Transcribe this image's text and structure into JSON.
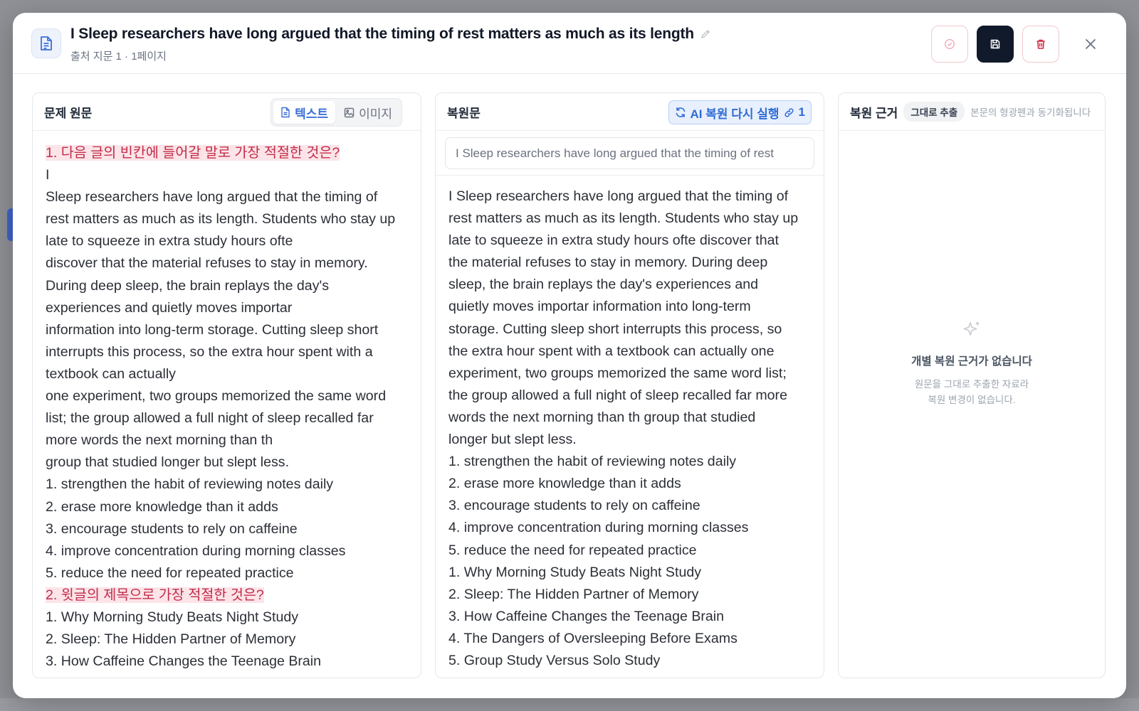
{
  "header": {
    "title": "I Sleep researchers have long argued that the timing of rest matters as much as its length",
    "subtitle": "출처 지문 1 · 1페이지"
  },
  "source_panel": {
    "title": "문제 원문",
    "tab_text": "텍스트",
    "tab_image": "이미지",
    "lines": [
      {
        "text": "1. 다음 글의 빈칸에 들어갈 말로 가장 적절한 것은?",
        "highlight": true
      },
      {
        "text": "I",
        "highlight": false
      },
      {
        "text": "Sleep researchers have long argued that the timing of",
        "highlight": false
      },
      {
        "text": "rest matters as much as its length. Students who stay up",
        "highlight": false
      },
      {
        "text": "late to squeeze in extra study hours ofte",
        "highlight": false
      },
      {
        "text": "discover that the material refuses to stay in memory.",
        "highlight": false
      },
      {
        "text": "During deep sleep, the brain replays the day's",
        "highlight": false
      },
      {
        "text": "experiences and quietly moves importar",
        "highlight": false
      },
      {
        "text": "information into long-term storage. Cutting sleep short",
        "highlight": false
      },
      {
        "text": "interrupts this process, so the extra hour spent with a",
        "highlight": false
      },
      {
        "text": "textbook can actually",
        "highlight": false
      },
      {
        "text": "one experiment, two groups memorized the same word",
        "highlight": false
      },
      {
        "text": "list; the group allowed a full night of sleep recalled far",
        "highlight": false
      },
      {
        "text": "more words the next morning than th",
        "highlight": false
      },
      {
        "text": "group that studied longer but slept less.",
        "highlight": false
      },
      {
        "text": "1. strengthen the habit of reviewing notes daily",
        "highlight": false
      },
      {
        "text": "2. erase more knowledge than it adds",
        "highlight": false
      },
      {
        "text": "3. encourage students to rely on caffeine",
        "highlight": false
      },
      {
        "text": "4. improve concentration during morning classes",
        "highlight": false
      },
      {
        "text": "5. reduce the need for repeated practice",
        "highlight": false
      },
      {
        "text": "2. 윗글의 제목으로 가장 적절한 것은?",
        "highlight": true
      },
      {
        "text": "1. Why Morning Study Beats Night Study",
        "highlight": false
      },
      {
        "text": "2. Sleep: The Hidden Partner of Memory",
        "highlight": false
      },
      {
        "text": "3. How Caffeine Changes the Teenage Brain",
        "highlight": false
      }
    ]
  },
  "restored_panel": {
    "title": "복원문",
    "rerun_label": "AI 복원 다시 실행",
    "rerun_count": "1",
    "search_value": "I Sleep researchers have long argued that the timing of rest",
    "lines": [
      "I Sleep researchers have long argued that the timing of",
      "rest matters as much as its length. Students who stay up",
      "late to squeeze in extra study hours ofte discover that",
      "the material refuses to stay in memory. During deep",
      "sleep, the brain replays the day's experiences and",
      "quietly moves importar information into long-term",
      "storage. Cutting sleep short interrupts this process, so",
      "the extra hour spent with a textbook can actually one",
      "experiment, two groups memorized the same word list;",
      "the group allowed a full night of sleep recalled far more",
      "words the next morning than th group that studied",
      "longer but slept less.",
      "1. strengthen the habit of reviewing notes daily",
      "2. erase more knowledge than it adds",
      "3. encourage students to rely on caffeine",
      "4. improve concentration during morning classes",
      "5. reduce the need for repeated practice",
      "1. Why Morning Study Beats Night Study",
      "2. Sleep: The Hidden Partner of Memory",
      "3. How Caffeine Changes the Teenage Brain",
      "4. The Dangers of Oversleeping Before Exams",
      "5. Group Study Versus Solo Study"
    ]
  },
  "basis_panel": {
    "title": "복원 근거",
    "chip": "그대로 추출",
    "hint": "본문의 형광펜과 동기화됩니다",
    "empty_title": "개별 복원 근거가 없습니다",
    "empty_desc_1": "원문을 그대로 추출한 자료라",
    "empty_desc_2": "복원 변경이 없습니다."
  },
  "colors": {
    "accent": "#3b6fd8",
    "highlight_bg": "#fce4e8",
    "highlight_text": "#c22d4a",
    "save_bg": "#111a2b"
  }
}
